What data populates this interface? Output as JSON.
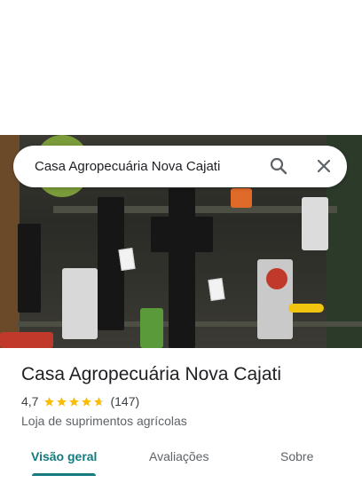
{
  "search": {
    "query": "Casa Agropecuária Nova Cajati",
    "search_icon": "search-icon",
    "close_icon": "close-icon"
  },
  "place": {
    "name": "Casa Agropecuária Nova Cajati",
    "rating": "4,7",
    "rating_fraction": 0.94,
    "reviews": "(147)",
    "category": "Loja de suprimentos agrícolas"
  },
  "tabs": [
    {
      "label": "Visão geral",
      "active": true
    },
    {
      "label": "Avaliações",
      "active": false
    },
    {
      "label": "Sobre",
      "active": false
    }
  ],
  "colors": {
    "accent": "#137a7f",
    "star": "#fbbc04"
  }
}
